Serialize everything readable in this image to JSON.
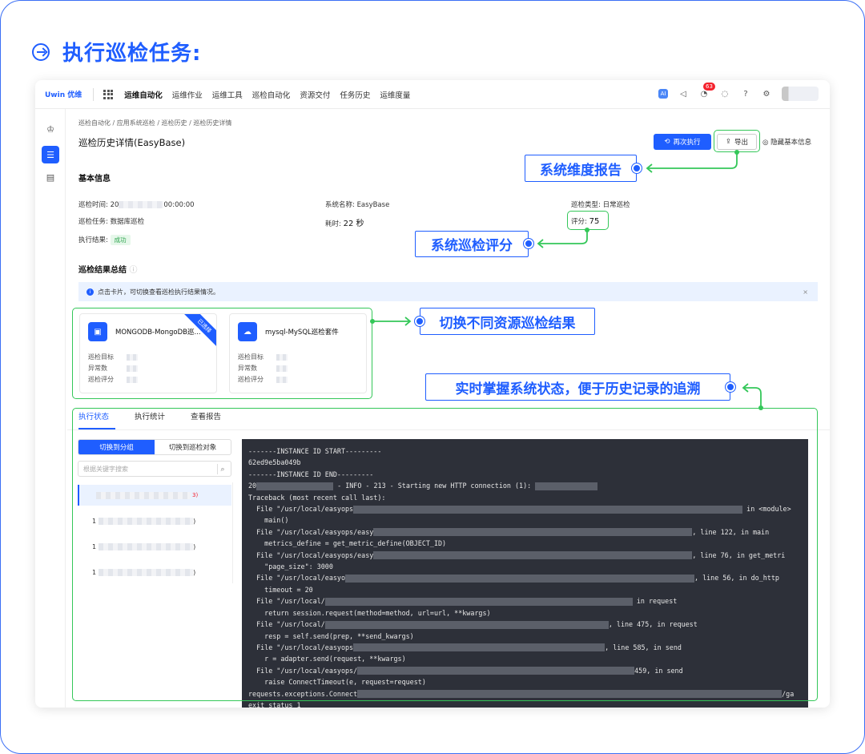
{
  "header": {
    "title": "执行巡检任务:"
  },
  "topbar": {
    "logo": "Uwin 优维",
    "nav": [
      "运维自动化",
      "运维作业",
      "运维工具",
      "巡检自动化",
      "资源交付",
      "任务历史",
      "运维度量"
    ],
    "badge_count": "63",
    "ai_label": "AI"
  },
  "page": {
    "breadcrumb": "巡检自动化 / 应用系统巡检 / 巡检历史 / 巡检历史详情",
    "title": "巡检历史详情(EasyBase)",
    "rerun_label": "再次执行",
    "export_label": "导出",
    "hide_info_label": "隐藏基本信息",
    "basic_info_title": "基本信息",
    "time_label": "巡检时间: 20",
    "time_suffix": "00:00:00",
    "task_label": "巡检任务: 数据库巡检",
    "result_label": "执行结果:",
    "result_tag": "成功",
    "system_name": "系统名称: EasyBase",
    "duration_label": "耗时:",
    "duration_value": "22 秒",
    "type_label": "巡检类型: 日常巡检",
    "score_label": "评分:",
    "score_value": "75",
    "summary_title": "巡检结果总结",
    "alert_text": "点击卡片，可切换查看巡检执行结果情况。",
    "alert_close": "×"
  },
  "cards": [
    {
      "name": "MONGODB-MongoDB巡...",
      "ribbon": "已选择",
      "rows": [
        "巡检目标",
        "异常数",
        "巡检评分"
      ]
    },
    {
      "name": "mysql-MySQL巡检套件",
      "rows": [
        "巡检目标",
        "异常数",
        "巡检评分"
      ]
    }
  ],
  "tabs": [
    "执行状态",
    "执行统计",
    "查看报告"
  ],
  "segment": [
    "切换到分组",
    "切换到巡检对象"
  ],
  "search_placeholder": "根据关键字搜索",
  "list": [
    {
      "prefix": "",
      "suffix": "3)"
    },
    {
      "prefix": "1",
      "suffix": ")"
    },
    {
      "prefix": "1",
      "suffix": ")"
    },
    {
      "prefix": "1",
      "suffix": ")"
    }
  ],
  "terminal": {
    "l1": "-------INSTANCE ID START---------",
    "l2": "62ed9e5ba049b",
    "l3": "-------INSTANCE ID END---------",
    "l4a": "20",
    "l4b": " - INFO - 213 - Starting new HTTP connection (1): ",
    "l5": "Traceback (most recent call last):",
    "l6a": "  File \"/usr/local/easyops",
    "l6b": " in <module>",
    "l7": "    main()",
    "l8a": "  File \"/usr/local/easyops/easy",
    "l8b": ", line 122, in main",
    "l9": "    metrics_define = get_metric_define(OBJECT_ID)",
    "l10a": "  File \"/usr/local/easyops/easy",
    "l10b": ", line 76, in get_metri",
    "l11": "    \"page_size\": 3000",
    "l12a": "  File \"/usr/local/easyo",
    "l12b": ", line 56, in do_http",
    "l13": "    timeout = 20",
    "l14a": "  File \"/usr/local/",
    "l14b": " in request",
    "l15": "    return session.request(method=method, url=url, **kwargs)",
    "l16a": "  File \"/usr/local/",
    "l16b": ", line 475, in request",
    "l17": "    resp = self.send(prep, **send_kwargs)",
    "l18a": "  File \"/usr/local/easyops",
    "l18b": ", line 585, in send",
    "l19": "    r = adapter.send(request, **kwargs)",
    "l20a": "  File \"/usr/local/easyops/",
    "l20b": "459, in send",
    "l21": "    raise ConnectTimeout(e, request=request)",
    "l22a": "requests.exceptions.Connect",
    "l22b": "/ga",
    "l23": "exit status 1"
  },
  "callouts": {
    "report": "系统维度报告",
    "score": "系统巡检评分",
    "switch": "切换不同资源巡检结果",
    "status": "实时掌握系统状态，便于历史记录的追溯"
  },
  "colors": {
    "accent": "#1f5eff",
    "highlight": "#34c759",
    "terminal_bg": "#2d3039"
  }
}
